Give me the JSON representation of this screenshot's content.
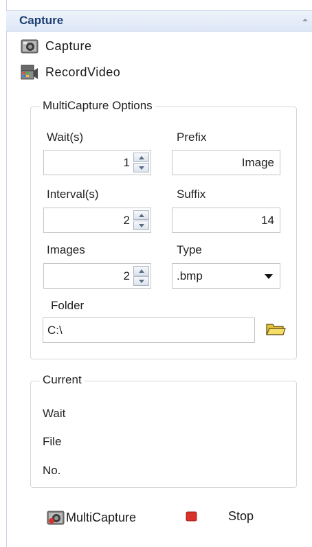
{
  "panel": {
    "title": "Capture"
  },
  "tools": {
    "capture_label": "Capture",
    "record_label": "RecordVideo"
  },
  "multicapture": {
    "legend": "MultiCapture Options",
    "wait_label": "Wait(s)",
    "wait_value": "1",
    "prefix_label": "Prefix",
    "prefix_value": "Image",
    "interval_label": "Interval(s)",
    "interval_value": "2",
    "suffix_label": "Suffix",
    "suffix_value": "14",
    "images_label": "Images",
    "images_value": "2",
    "type_label": "Type",
    "type_value": ".bmp",
    "folder_label": "Folder",
    "folder_value": "C:\\"
  },
  "current": {
    "legend": "Current",
    "wait_label": "Wait",
    "file_label": "File",
    "no_label": "No."
  },
  "actions": {
    "multicapture_label": "MultiCapture",
    "stop_label": "Stop"
  },
  "colors": {
    "header_text": "#1e3f73",
    "stop_red": "#d8322b"
  }
}
